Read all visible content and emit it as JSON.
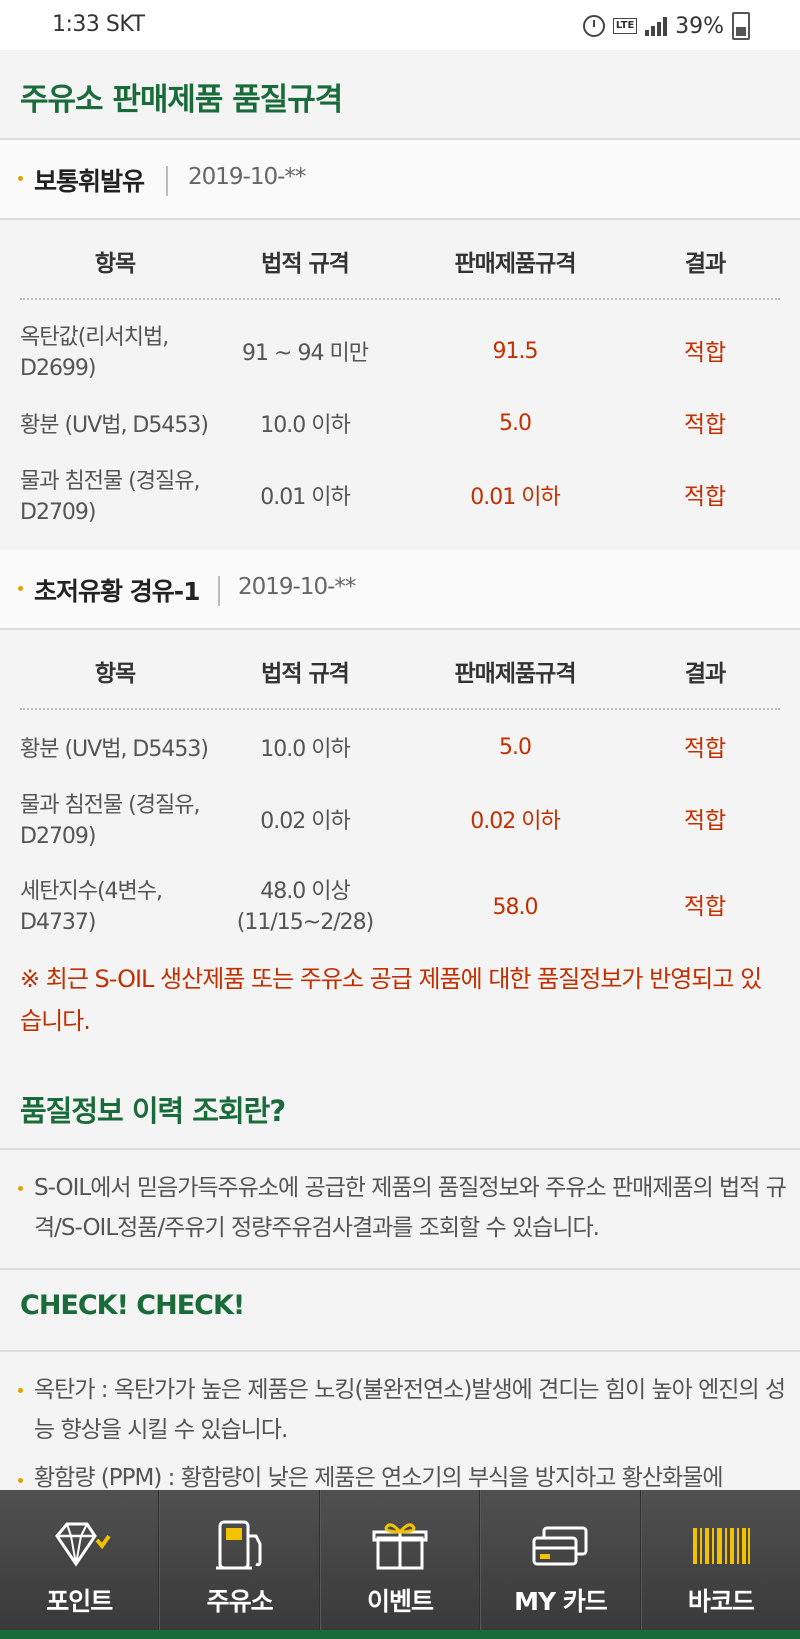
{
  "status_bar": {
    "time_carrier": "1:33 SKT",
    "battery": "39%"
  },
  "page_title": "주유소 판매제품 품질규격",
  "table_headers": [
    "항목",
    "법적 규격",
    "판매제품규격",
    "결과"
  ],
  "sections": [
    {
      "name": "보통휘발유",
      "date": "2019-10-**",
      "rows": [
        {
          "item": "옥탄값(리서치법, D2699)",
          "legal": "91 ~ 94 미만",
          "spec": "91.5",
          "result": "적합"
        },
        {
          "item": "황분 (UV법, D5453)",
          "legal": "10.0 이하",
          "spec": "5.0",
          "result": "적합"
        },
        {
          "item": "물과 침전물 (경질유, D2709)",
          "legal": "0.01 이하",
          "spec": "0.01 이하",
          "result": "적합"
        }
      ]
    },
    {
      "name": "초저유황 경유-1",
      "date": "2019-10-**",
      "rows": [
        {
          "item": "황분 (UV법, D5453)",
          "legal": "10.0 이하",
          "spec": "5.0",
          "result": "적합"
        },
        {
          "item": "물과 침전물 (경질유, D2709)",
          "legal": "0.02 이하",
          "spec": "0.02 이하",
          "result": "적합"
        },
        {
          "item": "세탄지수(4변수, D4737)",
          "legal": "48.0 이상 (11/15~2/28)",
          "spec": "58.0",
          "result": "적합"
        }
      ]
    }
  ],
  "notice": "※ 최근 S-OIL 생산제품 또는 주유소 공급 제품에 대한 품질정보가 반영되고 있습니다.",
  "history": {
    "title": "품질정보 이력 조회란?",
    "text": "S-OIL에서 믿음가득주유소에 공급한 제품의 품질정보와 주유소 판매제품의 법적 규격/S-OIL정품/주유기 정량주유검사결과를 조회할 수 있습니다."
  },
  "check": {
    "title": "CHECK! CHECK!",
    "items": [
      "옥탄가 : 옥탄가가 높은 제품은 노킹(불완전연소)발생에 견디는 힘이 높아 엔진의 성능 향상을 시킬 수 있습니다.",
      "황함량 (PPM) : 황함량이 낮은 제품은 연소기의 부식을 방지하고 황산화물에"
    ]
  },
  "nav": [
    {
      "label": "포인트",
      "icon": "diamond-icon"
    },
    {
      "label": "주유소",
      "icon": "fuel-pump-icon"
    },
    {
      "label": "이벤트",
      "icon": "gift-icon"
    },
    {
      "label": "MY 카드",
      "icon": "card-icon"
    },
    {
      "label": "바코드",
      "icon": "barcode-icon"
    }
  ],
  "colors": {
    "brand_green": "#1a6b3a",
    "accent_red": "#c33000",
    "barcode_yellow": "#f2c200"
  }
}
